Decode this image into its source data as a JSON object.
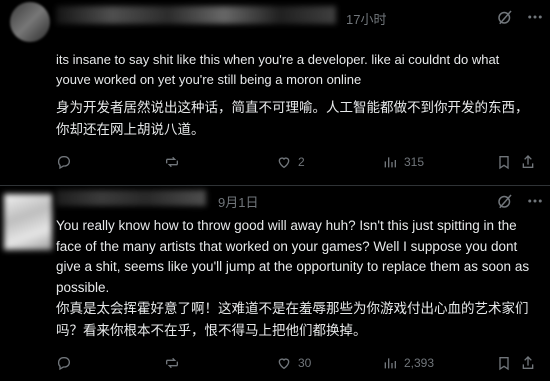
{
  "posts": [
    {
      "time": "17小时",
      "text_en": "its insane to say shit like this when you're a developer. like ai couldnt do what youve worked on yet you're still being a moron online",
      "text_cn": "身为开发者居然说出这种话，简直不可理喻。人工智能都做不到你开发的东西，你却还在网上胡说八道。",
      "actions": {
        "replies": "",
        "reposts": "",
        "likes": "2",
        "views": "315"
      }
    },
    {
      "time": "9月1日",
      "text_en": "You really know how to throw good will away huh? Isn't this just spitting in the face of the many artists that worked on your games? Well I suppose you dont give a shit, seems like you'll jump at the opportunity to replace them as soon as possible.",
      "text_cn": "你真是太会挥霍好意了啊！这难道不是在羞辱那些为你游戏付出心血的艺术家们吗？看来你根本不在乎，恨不得马上把他们都换掉。",
      "actions": {
        "replies": "",
        "reposts": "",
        "likes": "30",
        "views": "2,393"
      }
    }
  ],
  "colors": {
    "bg": "#000000",
    "text": "#e7e9ea",
    "muted": "#71767b",
    "divider": "#2f3336"
  }
}
